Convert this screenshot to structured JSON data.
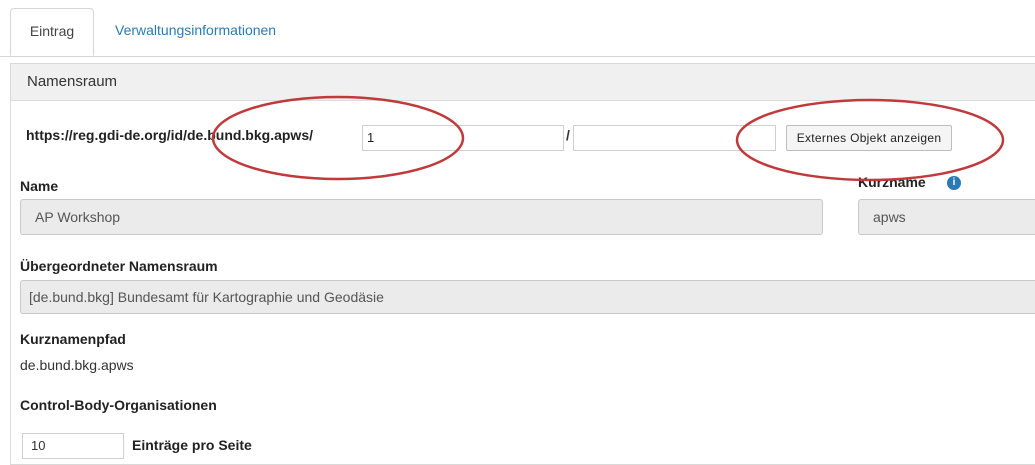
{
  "tabs": [
    {
      "label": "Eintrag",
      "active": true
    },
    {
      "label": "Verwaltungsinformationen",
      "active": false
    }
  ],
  "panel": {
    "title": "Namensraum"
  },
  "uri": {
    "prefix": "https://reg.gdi-de.org/id/de.bund.bkg.apws/",
    "part1_value": "1",
    "separator": "/",
    "part2_value": "",
    "button_label": "Externes Objekt anzeigen"
  },
  "name": {
    "label": "Name",
    "value": "AP Workshop"
  },
  "kurzname": {
    "label": "Kurzname",
    "value": "apws",
    "info_icon": "info-icon"
  },
  "parent_namespace": {
    "label": "Übergeordneter Namensraum",
    "value": "[de.bund.bkg] Bundesamt für Kartographie und Geodäsie"
  },
  "shortname_path": {
    "label": "Kurznamenpfad",
    "value": "de.bund.bkg.apws"
  },
  "control_body": {
    "label": "Control-Body-Organisationen",
    "entries_per_page_value": "10",
    "entries_per_page_label": "Einträge pro Seite"
  },
  "colors": {
    "accent": "#2a7ab5",
    "annotation": "#c0393b"
  }
}
